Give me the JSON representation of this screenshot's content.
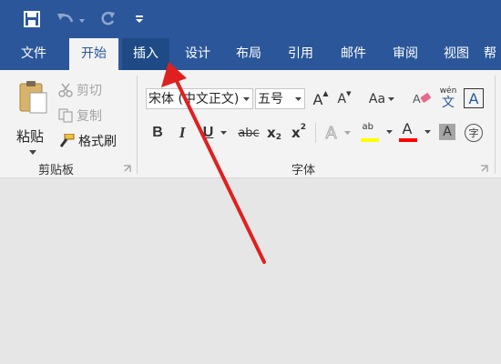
{
  "quick_access": {
    "save_icon": "save-icon",
    "undo_icon": "undo-icon",
    "redo_icon": "redo-icon",
    "customize_icon": "customize-dropdown-icon"
  },
  "tabs": [
    {
      "label": "文件",
      "state": "normal"
    },
    {
      "label": "开始",
      "state": "active"
    },
    {
      "label": "插入",
      "state": "hover"
    },
    {
      "label": "设计",
      "state": "normal"
    },
    {
      "label": "布局",
      "state": "normal"
    },
    {
      "label": "引用",
      "state": "normal"
    },
    {
      "label": "邮件",
      "state": "normal"
    },
    {
      "label": "审阅",
      "state": "normal"
    },
    {
      "label": "视图",
      "state": "normal"
    },
    {
      "label": "帮",
      "state": "normal"
    }
  ],
  "clipboard": {
    "paste_label": "粘贴",
    "cut_label": "剪切",
    "copy_label": "复制",
    "format_painter_label": "格式刷",
    "group_label": "剪贴板"
  },
  "font": {
    "font_name": "宋体 (中文正文)",
    "font_size": "五号",
    "group_label": "字体",
    "bold": "B",
    "italic": "I",
    "underline": "U",
    "strikethrough": "abc",
    "subscript": "x",
    "subscript_sub": "2",
    "superscript": "x",
    "superscript_sup": "2",
    "change_case": "Aa",
    "phonetic_top": "wén",
    "phonetic_bottom": "文",
    "char_border": "A",
    "text_effects": "A",
    "highlight": "ab",
    "font_color": "A",
    "char_shading": "A",
    "enclose": "字",
    "grow": "A",
    "shrink": "A"
  },
  "colors": {
    "brand": "#2b579a",
    "highlight_yellow": "#ffff00",
    "font_red": "#ff0000",
    "arrow_red": "#e02020"
  }
}
